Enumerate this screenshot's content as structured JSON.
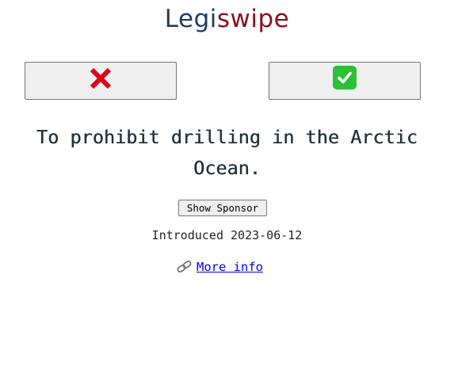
{
  "logo": {
    "part1": "Legi",
    "part2": "swipe"
  },
  "vote": {
    "no_icon": "cross-mark-icon",
    "yes_icon": "check-mark-button-icon",
    "no_color": "#e0001b",
    "yes_color": "#2dbf3a"
  },
  "bill": {
    "title": "To prohibit drilling in the Arctic Ocean.",
    "show_sponsor_label": "Show Sponsor",
    "introduced": "Introduced 2023-06-12",
    "more_info_label": "More info",
    "more_info_icon": "link-icon"
  },
  "colors": {
    "logo_primary": "#1c3f66",
    "logo_accent": "#8a1020",
    "link": "#0000ee"
  }
}
